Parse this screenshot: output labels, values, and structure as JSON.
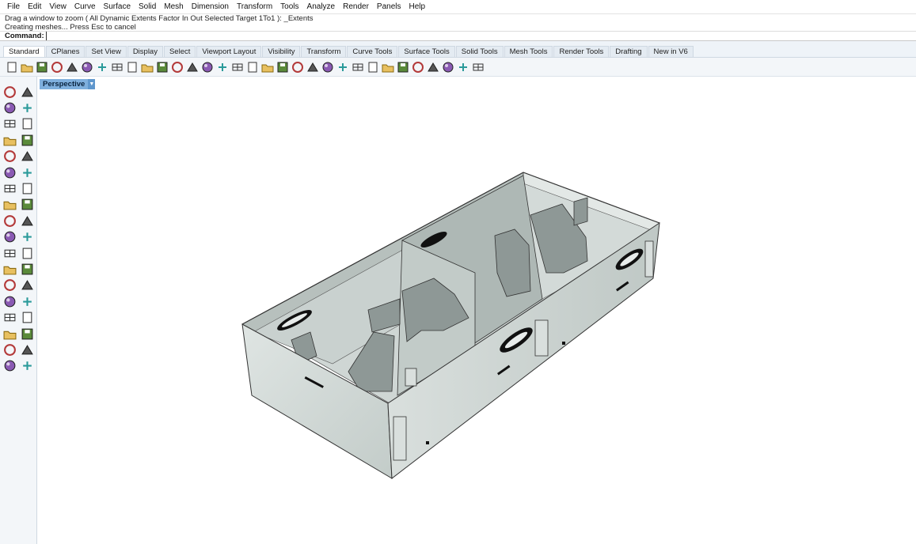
{
  "menu": [
    "File",
    "Edit",
    "View",
    "Curve",
    "Surface",
    "Solid",
    "Mesh",
    "Dimension",
    "Transform",
    "Tools",
    "Analyze",
    "Render",
    "Panels",
    "Help"
  ],
  "command_history": [
    "Drag a window to zoom ( All  Dynamic  Extents  Factor  In  Out  Selected  Target  1To1 ): _Extents",
    "Creating meshes... Press Esc to cancel"
  ],
  "command": {
    "label": "Command:",
    "value": ""
  },
  "toolbar_tabs": [
    {
      "label": "Standard",
      "active": true
    },
    {
      "label": "CPlanes"
    },
    {
      "label": "Set View"
    },
    {
      "label": "Display"
    },
    {
      "label": "Select"
    },
    {
      "label": "Viewport Layout"
    },
    {
      "label": "Visibility"
    },
    {
      "label": "Transform"
    },
    {
      "label": "Curve Tools"
    },
    {
      "label": "Surface Tools"
    },
    {
      "label": "Solid Tools"
    },
    {
      "label": "Mesh Tools"
    },
    {
      "label": "Render Tools"
    },
    {
      "label": "Drafting"
    },
    {
      "label": "New in V6"
    }
  ],
  "standard_icons": [
    "new-file-icon",
    "open-folder-icon",
    "save-icon",
    "print-icon",
    "import-icon",
    "cut-icon",
    "copy-icon",
    "paste-icon",
    "undo-icon",
    "pan-hand-icon",
    "move-view-icon",
    "zoom-icon",
    "zoom-window-icon",
    "zoom-extents-icon",
    "zoom-selected-icon",
    "rotate-view-icon",
    "four-viewports-icon",
    "red-car-icon",
    "hide-objects-icon",
    "show-objects-icon",
    "light-bulb-icon",
    "lock-icon",
    "layer-icon",
    "color-wheel-icon",
    "render-sphere-icon",
    "material-sphere-icon",
    "blue-sphere-icon",
    "highlighter-icon",
    "gear-settings-icon",
    "grasshopper-icon",
    "globe-icon",
    "help-icon"
  ],
  "left_tools": [
    [
      "select-arrow-icon",
      "point-icon"
    ],
    [
      "polyline-icon",
      "curve-icon"
    ],
    [
      "circle-icon",
      "ellipse-icon"
    ],
    [
      "polygon-icon",
      "rectangle-icon"
    ],
    [
      "arc-icon",
      "fillet-curve-icon"
    ],
    [
      "offset-curve-icon",
      "surface-icon"
    ],
    [
      "solid-box-icon",
      "solid-sphere-icon"
    ],
    [
      "cylinder-icon",
      "extrude-icon"
    ],
    [
      "mesh-icon",
      "explode-icon"
    ],
    [
      "boolean-icon",
      "split-icon"
    ],
    [
      "join-icon",
      "group-icon"
    ],
    [
      "trim-icon",
      "rebuild-icon"
    ],
    [
      "text-icon",
      "dimension-icon"
    ],
    [
      "array-icon",
      "mirror-icon"
    ],
    [
      "block-icon",
      "analyze-icon"
    ],
    [
      "grid-icon",
      "gumball-icon"
    ],
    [
      "checkbox-icon",
      "check-icon"
    ],
    [
      "render-icon",
      "paint-icon"
    ]
  ],
  "viewport": {
    "label": "Perspective",
    "menu_arrow": "▼"
  },
  "colors": {
    "viewport_tab": "#7fb0de",
    "toolbar_bg": "#f3f6f9",
    "model_shade": "#c9d1cf"
  }
}
